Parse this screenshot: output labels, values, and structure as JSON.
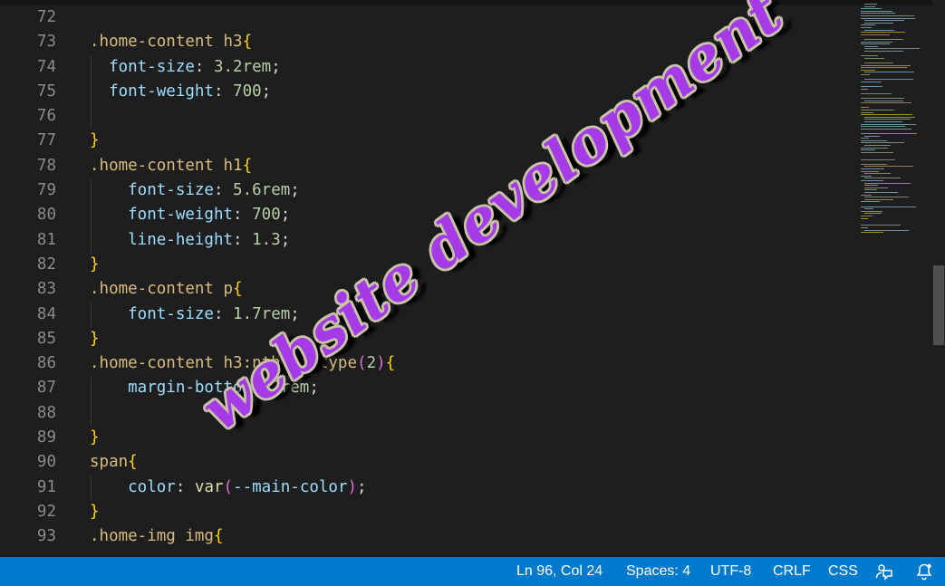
{
  "editor": {
    "lines": [
      {
        "n": "72",
        "tokens": []
      },
      {
        "n": "73",
        "tokens": [
          {
            "t": ".home-content h3",
            "c": "sel"
          },
          {
            "t": "{",
            "c": "b1"
          }
        ]
      },
      {
        "n": "74",
        "tokens": [
          {
            "t": "  font-size",
            "c": "prop"
          },
          {
            "t": ": ",
            "c": "punc"
          },
          {
            "t": "3.2rem",
            "c": "num"
          },
          {
            "t": ";",
            "c": "punc"
          }
        ]
      },
      {
        "n": "75",
        "tokens": [
          {
            "t": "  font-weight",
            "c": "prop"
          },
          {
            "t": ": ",
            "c": "punc"
          },
          {
            "t": "700",
            "c": "num"
          },
          {
            "t": ";",
            "c": "punc"
          }
        ]
      },
      {
        "n": "76",
        "tokens": []
      },
      {
        "n": "77",
        "tokens": [
          {
            "t": "}",
            "c": "b1"
          }
        ]
      },
      {
        "n": "78",
        "tokens": [
          {
            "t": ".home-content h1",
            "c": "sel"
          },
          {
            "t": "{",
            "c": "b1"
          }
        ]
      },
      {
        "n": "79",
        "tokens": [
          {
            "t": "    font-size",
            "c": "prop"
          },
          {
            "t": ": ",
            "c": "punc"
          },
          {
            "t": "5.6rem",
            "c": "num"
          },
          {
            "t": ";",
            "c": "punc"
          }
        ]
      },
      {
        "n": "80",
        "tokens": [
          {
            "t": "    font-weight",
            "c": "prop"
          },
          {
            "t": ": ",
            "c": "punc"
          },
          {
            "t": "700",
            "c": "num"
          },
          {
            "t": ";",
            "c": "punc"
          }
        ]
      },
      {
        "n": "81",
        "tokens": [
          {
            "t": "    line-height",
            "c": "prop"
          },
          {
            "t": ": ",
            "c": "punc"
          },
          {
            "t": "1.3",
            "c": "num"
          },
          {
            "t": ";",
            "c": "punc"
          }
        ]
      },
      {
        "n": "82",
        "tokens": [
          {
            "t": "}",
            "c": "b1"
          }
        ]
      },
      {
        "n": "83",
        "tokens": [
          {
            "t": ".home-content p",
            "c": "sel"
          },
          {
            "t": "{",
            "c": "b1"
          }
        ]
      },
      {
        "n": "84",
        "tokens": [
          {
            "t": "    font-size",
            "c": "prop"
          },
          {
            "t": ": ",
            "c": "punc"
          },
          {
            "t": "1.7rem",
            "c": "num"
          },
          {
            "t": ";",
            "c": "punc"
          }
        ]
      },
      {
        "n": "85",
        "tokens": [
          {
            "t": "}",
            "c": "b1"
          }
        ]
      },
      {
        "n": "86",
        "tokens": [
          {
            "t": ".home-content h3:nth-of-type",
            "c": "sel"
          },
          {
            "t": "(",
            "c": "b2"
          },
          {
            "t": "2",
            "c": "num"
          },
          {
            "t": ")",
            "c": "b2"
          },
          {
            "t": "{",
            "c": "b1"
          }
        ]
      },
      {
        "n": "87",
        "tokens": [
          {
            "t": "    margin-bottom",
            "c": "prop"
          },
          {
            "t": ": ",
            "c": "punc"
          },
          {
            "t": "3rem",
            "c": "num"
          },
          {
            "t": ";",
            "c": "punc"
          }
        ]
      },
      {
        "n": "88",
        "tokens": []
      },
      {
        "n": "89",
        "tokens": [
          {
            "t": "}",
            "c": "b1"
          }
        ]
      },
      {
        "n": "90",
        "tokens": [
          {
            "t": "span",
            "c": "sel"
          },
          {
            "t": "{",
            "c": "b1"
          }
        ]
      },
      {
        "n": "91",
        "tokens": [
          {
            "t": "    color",
            "c": "prop"
          },
          {
            "t": ": ",
            "c": "punc"
          },
          {
            "t": "var",
            "c": "fn"
          },
          {
            "t": "(",
            "c": "b2"
          },
          {
            "t": "--main-color",
            "c": "prop"
          },
          {
            "t": ")",
            "c": "b2"
          },
          {
            "t": ";",
            "c": "punc"
          }
        ]
      },
      {
        "n": "92",
        "tokens": [
          {
            "t": "}",
            "c": "b1"
          }
        ]
      },
      {
        "n": "93",
        "tokens": [
          {
            "t": ".home-img img",
            "c": "sel"
          },
          {
            "t": "{",
            "c": "b1"
          }
        ]
      }
    ]
  },
  "watermark": {
    "text": "website development",
    "color": "#a43be6"
  },
  "statusbar": {
    "position": "Ln 96, Col 24",
    "indentation": "Spaces: 4",
    "encoding": "UTF-8",
    "eol": "CRLF",
    "language": "CSS",
    "feedback_icon": "feedback-icon",
    "bell_icon": "notification-bell-icon",
    "background": "#007acc"
  }
}
